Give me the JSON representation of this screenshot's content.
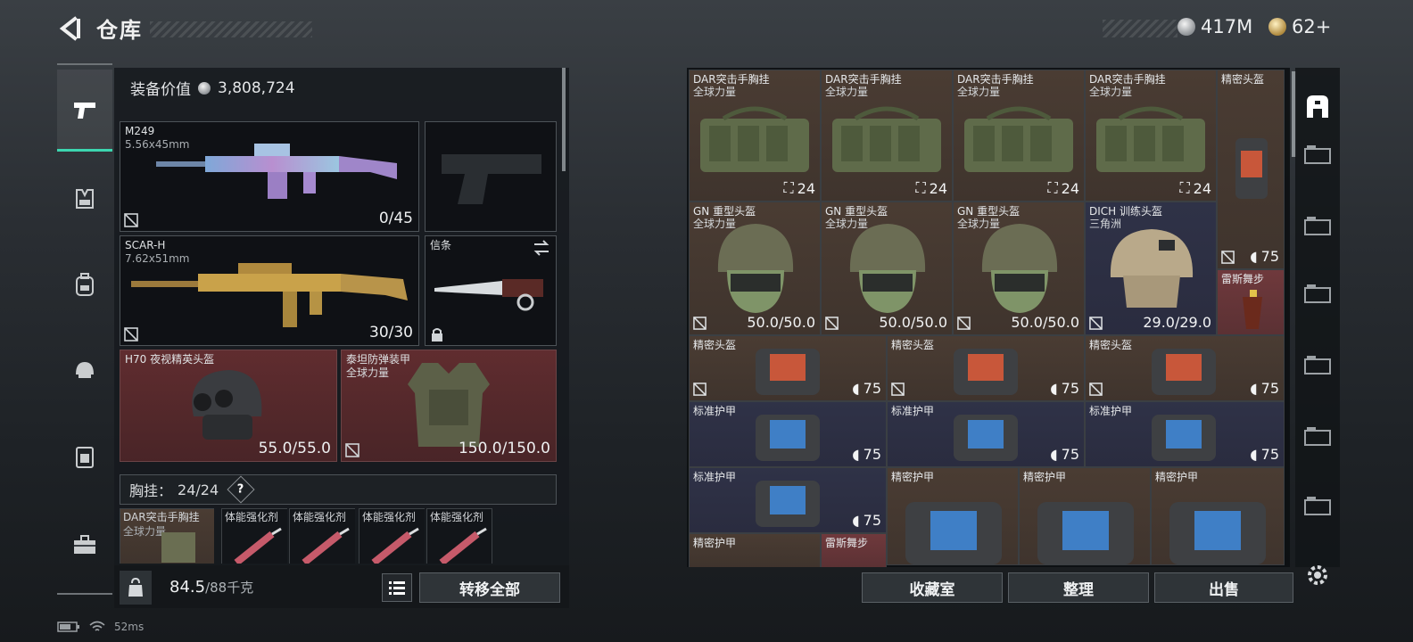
{
  "header": {
    "title": "仓库",
    "currency_silver": "417M",
    "currency_gold": "62+"
  },
  "rail": {
    "items": [
      "weapons",
      "chest-rig",
      "backpack",
      "helmet",
      "armor",
      "toolbox"
    ]
  },
  "loadout": {
    "equip_value_label": "装备价值",
    "equip_value": "3,808,724",
    "primary": {
      "name": "M249",
      "caliber": "5.56x45mm",
      "ammo": "0/45"
    },
    "secondary": {
      "name": "SCAR-H",
      "caliber": "7.62x51mm",
      "ammo": "30/30"
    },
    "melee": {
      "name": "信条"
    },
    "helmet": {
      "name": "H70 夜视精英头盔",
      "durability": "55.0/55.0"
    },
    "armor": {
      "name": "泰坦防弹装甲",
      "sub": "全球力量",
      "durability": "150.0/150.0"
    },
    "chest_rig": {
      "label": "胸挂：",
      "capacity": "24/24",
      "help": "?"
    },
    "mini_items": [
      {
        "name": "DAR突击手胸挂",
        "sub": "全球力量"
      },
      {
        "name": "体能强化剂"
      },
      {
        "name": "体能强化剂"
      },
      {
        "name": "体能强化剂"
      },
      {
        "name": "体能强化剂"
      }
    ],
    "weight": "84.5",
    "weight_max": "/88千克",
    "transfer_all": "转移全部"
  },
  "stash": {
    "row1": [
      {
        "name": "DAR突击手胸挂",
        "sub": "全球力量",
        "value": "24"
      },
      {
        "name": "DAR突击手胸挂",
        "sub": "全球力量",
        "value": "24"
      },
      {
        "name": "DAR突击手胸挂",
        "sub": "全球力量",
        "value": "24"
      },
      {
        "name": "DAR突击手胸挂",
        "sub": "全球力量",
        "value": "24"
      },
      {
        "name": "精密头盔",
        "value": "75"
      }
    ],
    "row2": [
      {
        "name": "GN 重型头盔",
        "sub": "全球力量",
        "value": "50.0/50.0"
      },
      {
        "name": "GN 重型头盔",
        "sub": "全球力量",
        "value": "50.0/50.0"
      },
      {
        "name": "GN 重型头盔",
        "sub": "全球力量",
        "value": "50.0/50.0"
      },
      {
        "name": "DICH 训练头盔",
        "sub": "三角洲",
        "value": "29.0/29.0"
      },
      {
        "name": "雷斯舞步"
      }
    ],
    "row3": [
      {
        "name": "精密头盔",
        "value": "75"
      },
      {
        "name": "精密头盔",
        "value": "75"
      },
      {
        "name": "精密头盔",
        "value": "75"
      }
    ],
    "row4": [
      {
        "name": "标准护甲",
        "value": "75"
      },
      {
        "name": "标准护甲",
        "value": "75"
      },
      {
        "name": "标准护甲",
        "value": "75"
      }
    ],
    "row5": [
      {
        "name": "标准护甲",
        "value": "75"
      },
      {
        "name": "精密护甲"
      },
      {
        "name": "精密护甲"
      },
      {
        "name": "精密护甲"
      }
    ],
    "row6": [
      {
        "name": "精密护甲"
      },
      {
        "name": "雷斯舞步"
      }
    ]
  },
  "actions": {
    "collection": "收藏室",
    "organize": "整理",
    "sell": "出售"
  },
  "status": {
    "ping": "52ms"
  },
  "colors": {
    "accent": "#3cd6b0",
    "cell_brown": "#4a3c33",
    "cell_navy": "#2f3247",
    "cell_red": "#6f393c"
  }
}
